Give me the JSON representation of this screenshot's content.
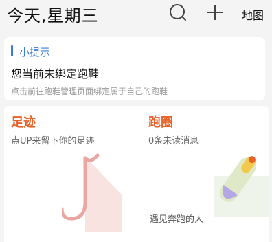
{
  "header": {
    "title": "今天,星期三",
    "map_label": "地图",
    "icons": [
      "search-icon",
      "add-icon"
    ]
  },
  "tip": {
    "title": "小提示",
    "message": "您当前未绑定跑鞋",
    "detail": "点击前往跑鞋管理页面绑定属于自己的跑鞋",
    "accent": "#3a7bd5"
  },
  "tiles": {
    "footprint": {
      "title": "足迹",
      "subtitle": "点UP来留下你的足迹"
    },
    "run_circle": {
      "title": "跑圈",
      "subtitle": "0条未读消息",
      "footer": "遇见奔跑的人"
    },
    "accent": "#e8622a"
  }
}
